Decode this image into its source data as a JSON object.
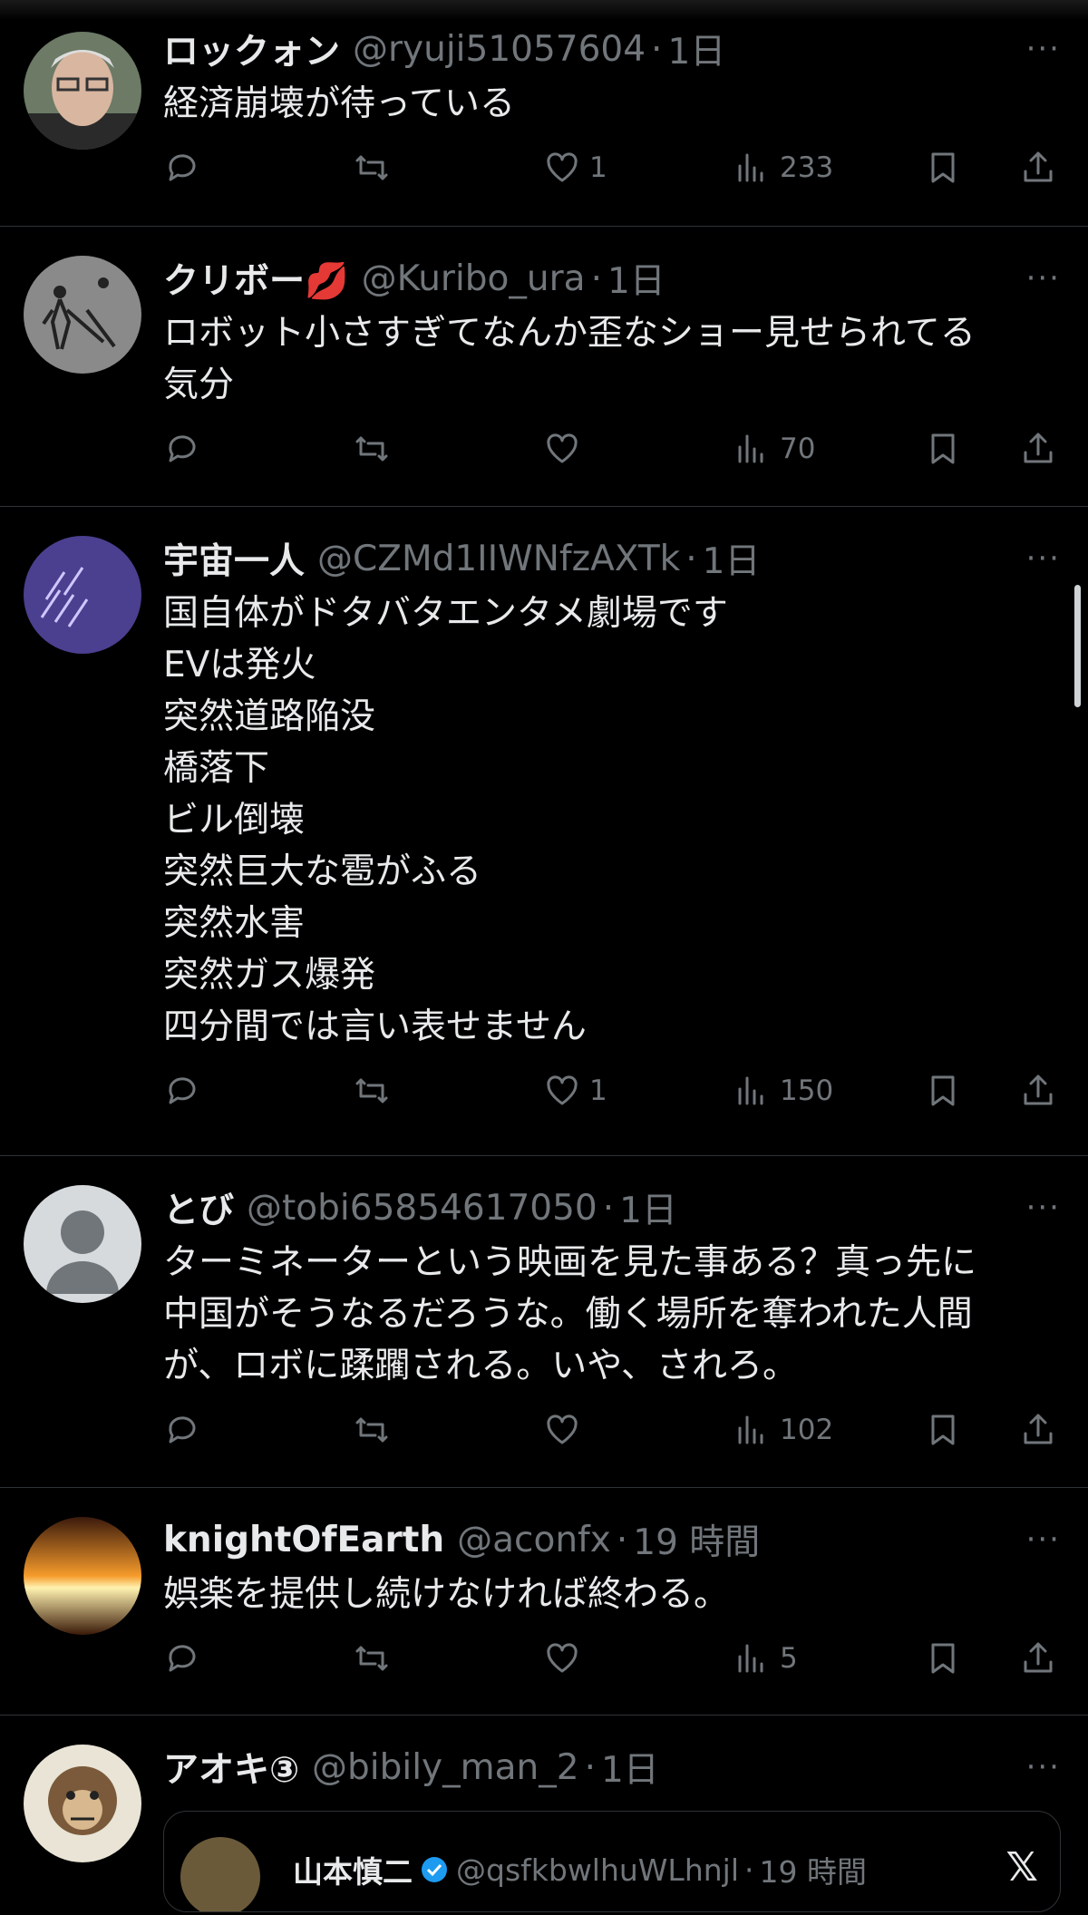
{
  "tweets": [
    {
      "name": "ロックォン",
      "handle": "@ryuji51057604",
      "time": "1日",
      "lines": [
        "経済崩壊が待っている"
      ],
      "likes": "1",
      "views": "233"
    },
    {
      "name": "クリボー💋",
      "handle": "@Kuribo_ura",
      "time": "1日",
      "lines": [
        "ロボット小さすぎてなんか歪なショー見せられてる",
        "気分"
      ],
      "likes": "",
      "views": "70"
    },
    {
      "name": "宇宙一人",
      "handle": "@CZMd1IIWNfzAXTk",
      "time": "1日",
      "lines": [
        "国自体がドタバタエンタメ劇場です",
        "EVは発火",
        "突然道路陥没",
        "橋落下",
        "ビル倒壊",
        "突然巨大な雹がふる",
        "突然水害",
        "突然ガス爆発",
        "四分間では言い表せません"
      ],
      "likes": "1",
      "views": "150"
    },
    {
      "name": "とび",
      "handle": "@tobi65854617050",
      "time": "1日",
      "lines": [
        "ターミネーターという映画を見た事ある？真っ先に",
        "中国がそうなるだろうな。働く場所を奪われた人間",
        "が、ロボに蹂躙される。いや、されろ。"
      ],
      "likes": "",
      "views": "102"
    },
    {
      "name": "knightOfEarth",
      "handle": "@aconfx",
      "time": "19 時間",
      "lines": [
        "娯楽を提供し続けなければ終わる。"
      ],
      "likes": "",
      "views": "5"
    },
    {
      "name": "アオキ③",
      "handle": "@bibily_man_2",
      "time": "1日"
    }
  ],
  "quote": {
    "name": "山本慎二",
    "handle": "@qsfkbwlhuWLhnjl",
    "time": "19 時間",
    "logo": "𝕏"
  },
  "separator_dot": "·",
  "more_label": "···"
}
